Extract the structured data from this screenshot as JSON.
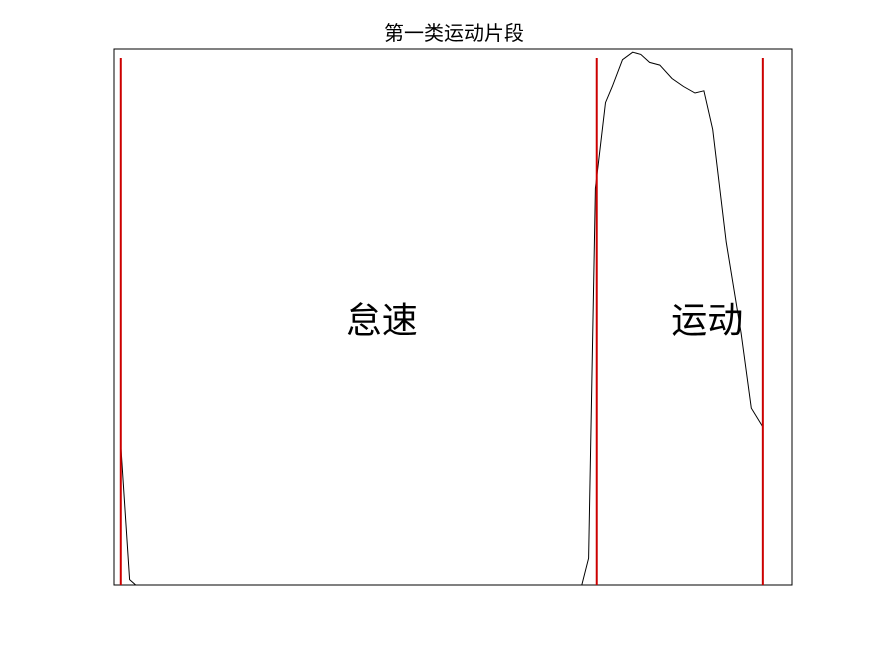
{
  "chart_data": {
    "type": "line",
    "title": "第一类运动片段",
    "xlabel": "",
    "ylabel": "",
    "xlim": [
      0,
      100
    ],
    "ylim": [
      0,
      100
    ],
    "grid": false,
    "axis_ticks": false,
    "series": [
      {
        "color": "#000000",
        "x": [
          1,
          2.3,
          3.2,
          69,
          70,
          71,
          72.5,
          73.5,
          75,
          76.5,
          77.7,
          79,
          80.5,
          82.3,
          84,
          85.7,
          87,
          88.3,
          90.3,
          92.5,
          94,
          95.7
        ],
        "y": [
          26,
          1,
          0,
          0,
          5,
          74,
          90,
          93,
          98,
          99.4,
          99,
          97.5,
          97,
          94.5,
          93,
          91.8,
          92.2,
          85,
          64,
          47,
          33,
          29.5
        ]
      }
    ],
    "annotations": [
      {
        "label": "怠速",
        "x": 39.5,
        "y": 49
      },
      {
        "label": "运动",
        "x": 87.5,
        "y": 49
      }
    ],
    "vlines": {
      "color": "#cc0000",
      "x": [
        1,
        71.2,
        95.7
      ]
    }
  }
}
